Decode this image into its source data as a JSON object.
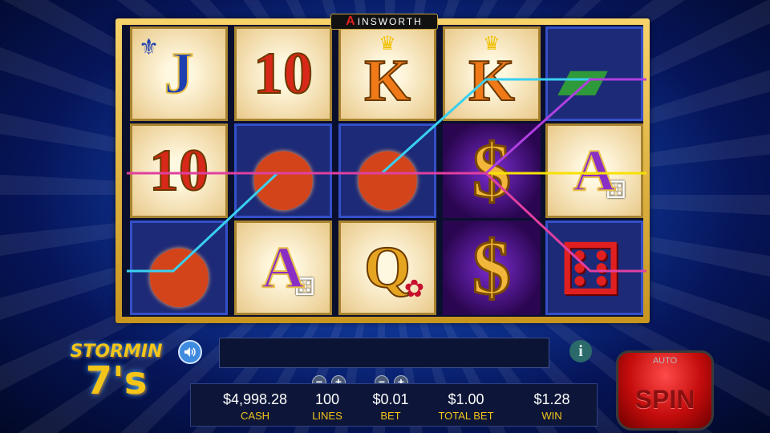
{
  "brand": {
    "logo_letter": "A",
    "name": "INSWORTH"
  },
  "reels": [
    [
      {
        "glyph": "J",
        "style": "g-blue",
        "bg": "card",
        "decor": "⚜"
      },
      {
        "glyph": "10",
        "style": "g-red",
        "bg": "card"
      },
      {
        "glyph": "",
        "style": "",
        "bg": "dark",
        "decor": "chips"
      }
    ],
    [
      {
        "glyph": "10",
        "style": "g-red",
        "bg": "card"
      },
      {
        "glyph": "",
        "style": "",
        "bg": "dark",
        "decor": "chips"
      },
      {
        "glyph": "A",
        "style": "g-purple",
        "bg": "card",
        "decor": "dice"
      }
    ],
    [
      {
        "glyph": "K",
        "style": "g-orange",
        "bg": "card",
        "decor": "crown"
      },
      {
        "glyph": "",
        "style": "",
        "bg": "dark",
        "decor": "chips"
      },
      {
        "glyph": "Q",
        "style": "g-gold",
        "bg": "card",
        "decor": "rose"
      }
    ],
    [
      {
        "glyph": "K",
        "style": "g-orange",
        "bg": "card",
        "decor": "crown"
      },
      {
        "glyph": "$",
        "style": "g-dollar",
        "bg": "purple"
      },
      {
        "glyph": "$",
        "style": "g-dollar",
        "bg": "purple"
      }
    ],
    [
      {
        "glyph": "",
        "style": "",
        "bg": "dark",
        "decor": "cash"
      },
      {
        "glyph": "A",
        "style": "g-purple",
        "bg": "card",
        "decor": "dice"
      },
      {
        "glyph": "",
        "style": "",
        "bg": "dark",
        "decor": "red-dice"
      }
    ]
  ],
  "paylines": [
    {
      "color": "#39d0f0",
      "rows": [
        2,
        1,
        1,
        0,
        0
      ]
    },
    {
      "color": "#f7e100",
      "rows": [
        1,
        1,
        1,
        1,
        1
      ]
    },
    {
      "color": "#b040e0",
      "rows": [
        1,
        1,
        1,
        1,
        0
      ]
    },
    {
      "color": "#e040a0",
      "rows": [
        1,
        1,
        1,
        1,
        2
      ]
    }
  ],
  "game_logo": {
    "line1": "STORMIN",
    "line2": "7's"
  },
  "message": "",
  "stats": {
    "cash": {
      "value": "$4,998.28",
      "label": "CASH"
    },
    "lines": {
      "value": "100",
      "label": "LINES"
    },
    "bet": {
      "value": "$0.01",
      "label": "BET"
    },
    "total_bet": {
      "value": "$1.00",
      "label": "TOTAL BET"
    },
    "win": {
      "value": "$1.28",
      "label": "WIN"
    }
  },
  "controls": {
    "minus": "−",
    "plus": "+",
    "info": "i",
    "sound_icon": "speaker-icon"
  },
  "spin": {
    "auto_label": "AUTO",
    "label": "SPIN"
  }
}
